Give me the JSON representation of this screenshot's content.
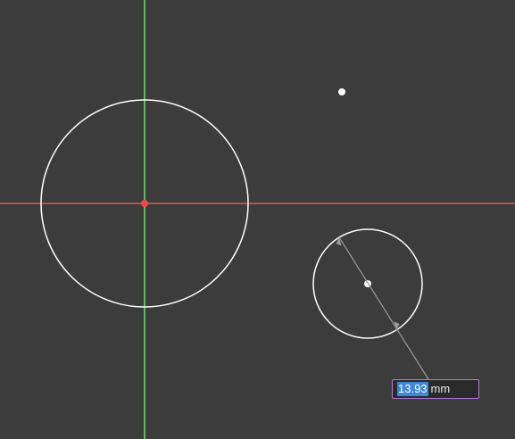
{
  "colors": {
    "background": "#3c3c3c",
    "x_axis": "#e05a5a",
    "y_axis": "#6ee06e",
    "sketch_geometry": "#ffffff",
    "dimension_line": "#9a9a9a",
    "origin_point": "#f04848",
    "input_border": "#b07ad8",
    "input_selection": "#3d86d8"
  },
  "dimension_input": {
    "value": "13.93",
    "unit": "mm"
  }
}
